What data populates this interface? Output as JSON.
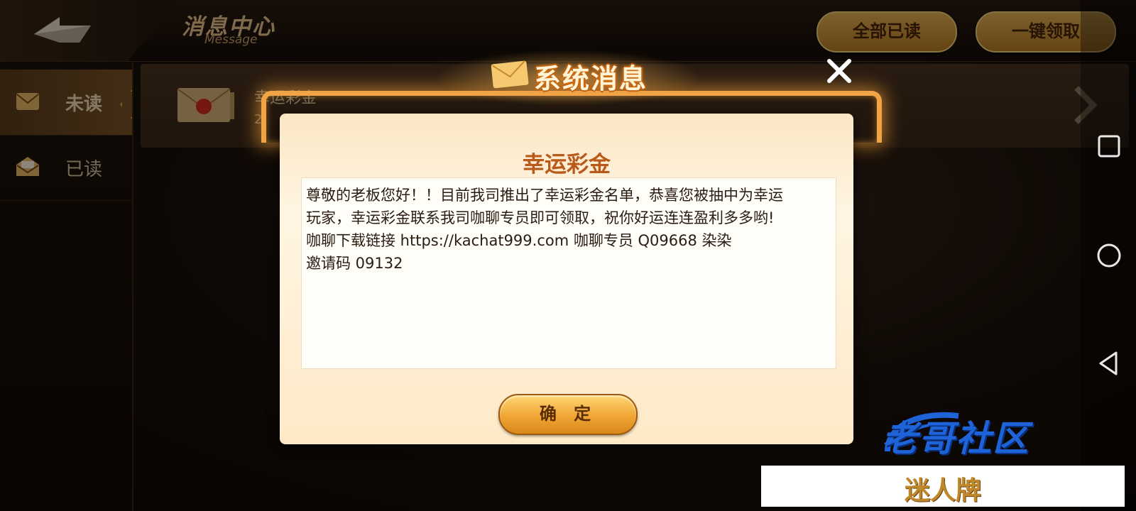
{
  "header": {
    "title": "消息中心",
    "subtitle": "Message",
    "mark_all_read": "全部已读",
    "claim_all": "一键领取"
  },
  "sidebar": {
    "items": [
      {
        "label": "未读",
        "icon": "envelope-closed-icon",
        "active": true
      },
      {
        "label": "已读",
        "icon": "envelope-open-icon",
        "active": false
      }
    ]
  },
  "message_row": {
    "title": "幸运彩金",
    "date_prefix": "2"
  },
  "dialog": {
    "header": "系统消息",
    "message_title": "幸运彩金",
    "body_lines": [
      "尊敬的老板您好！！目前我司推出了幸运彩金名单，恭喜您被抽中为幸运",
      "玩家，幸运彩金联系我司咖聊专员即可领取，祝你好运连连盈利多多哟!",
      "咖聊下载链接   https://kachat999.com   咖聊专员   Q09668    染染",
      "邀请码    09132"
    ],
    "confirm": "确 定"
  },
  "watermark": {
    "text": "老哥社区",
    "stamp": "迷人牌"
  },
  "colors": {
    "gold": "#e2b052",
    "brown_text": "#4a2608",
    "title_orange": "#b95a1a",
    "glow": "#f0a446"
  }
}
